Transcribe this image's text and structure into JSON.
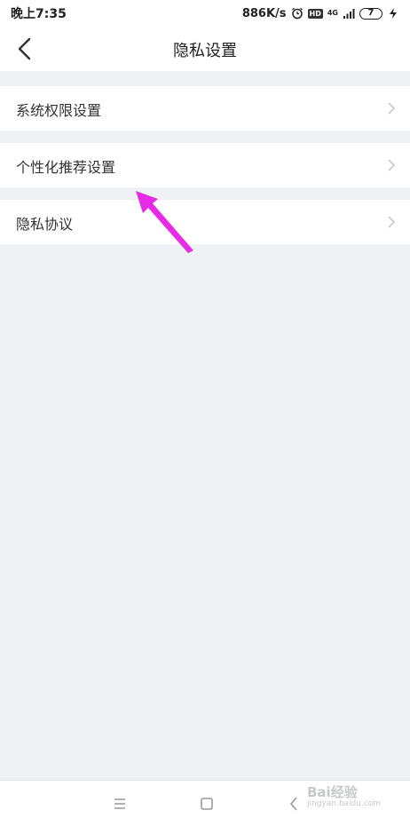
{
  "statusbar": {
    "time": "晚上7:35",
    "speed": "886K/s",
    "hd": "HD",
    "network": "4G",
    "battery": "7"
  },
  "header": {
    "title": "隐私设置"
  },
  "list": {
    "items": [
      {
        "label": "系统权限设置"
      },
      {
        "label": "个性化推荐设置"
      },
      {
        "label": "隐私协议"
      }
    ]
  },
  "colors": {
    "background": "#eef2f4",
    "card": "#ffffff",
    "annotation": "#e62be6"
  },
  "watermark": {
    "brand": "Bai经验",
    "url": "jingyan.baidu.com"
  }
}
